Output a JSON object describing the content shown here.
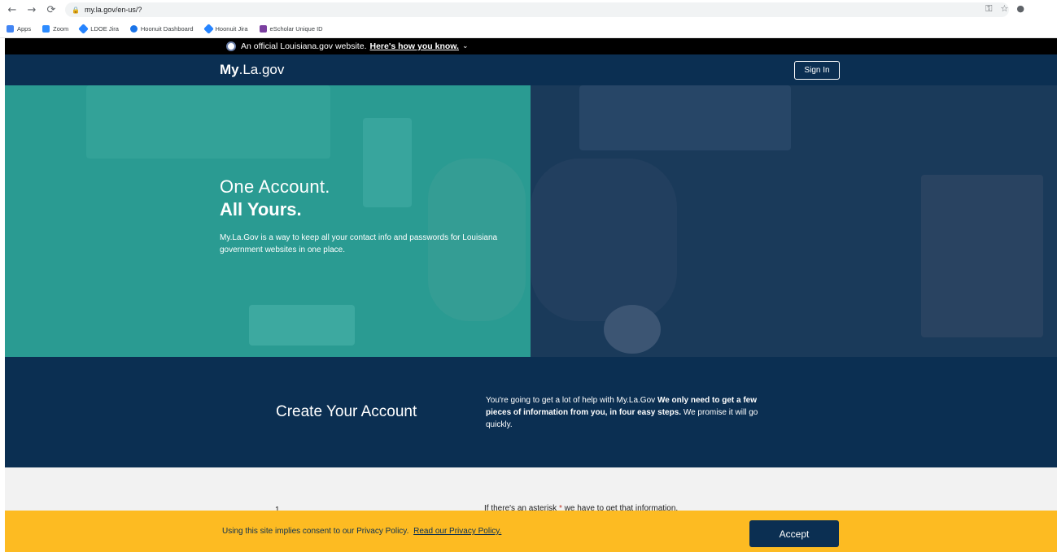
{
  "browser": {
    "url": "my.la.gov/en-us/?",
    "bookmarks": [
      {
        "label": "Apps",
        "color": "#4285f4"
      },
      {
        "label": "Zoom",
        "color": "#2d8cff"
      },
      {
        "label": "LDOE Jira",
        "color": "#2684ff"
      },
      {
        "label": "Hoonuit Dashboard",
        "color": "#1a73e8"
      },
      {
        "label": "Hoonuit Jira",
        "color": "#2684ff"
      },
      {
        "label": "eScholar Unique ID",
        "color": "#7b3fa0"
      }
    ]
  },
  "banner": {
    "text": "An official Louisiana.gov website.",
    "link": "Here's how you know."
  },
  "header": {
    "logo_bold": "My",
    "logo_rest": ".La.gov",
    "signin_label": "Sign In"
  },
  "hero": {
    "line1": "One Account.",
    "line2": "All Yours.",
    "description": "My.La.Gov is a way to keep all your contact info and passwords for Louisiana government websites in one place."
  },
  "create": {
    "title": "Create Your Account",
    "text_plain": "You're going to get a lot of help with My.La.Gov ",
    "text_bold": "We only need to get a few pieces of information from you, in four easy steps.",
    "text_end": " We promise it will go quickly."
  },
  "steps": {
    "number": "1",
    "note_start": "If there's an asterisk ",
    "note_star": "*",
    "note_end": " we have to get that information."
  },
  "cookie": {
    "text": "Using this site implies consent to our Privacy Policy.",
    "link": "Read our Privacy Policy.",
    "accept_label": "Accept"
  },
  "colors": {
    "navy": "#0b2f52",
    "teal": "#2a9b92",
    "gold": "#fdbb22"
  }
}
